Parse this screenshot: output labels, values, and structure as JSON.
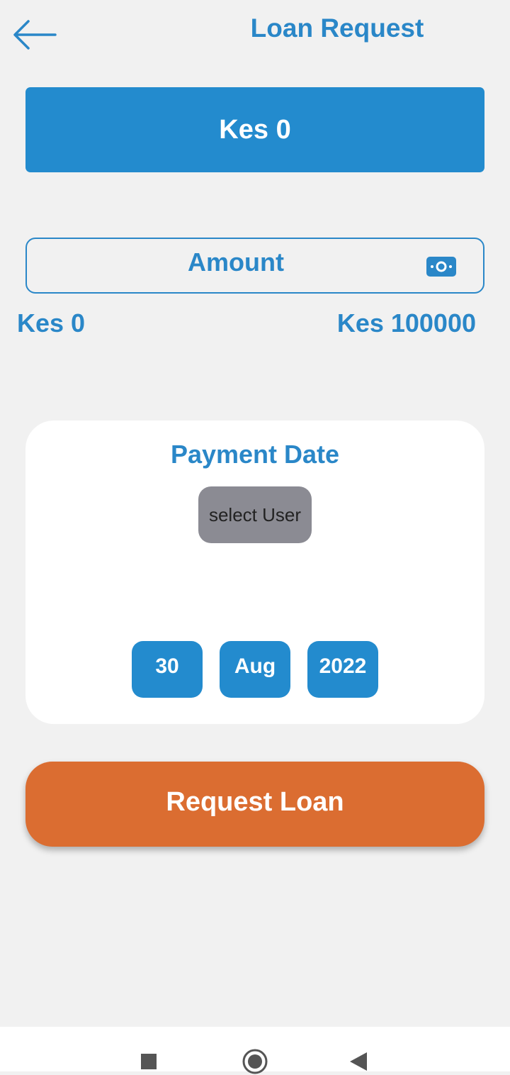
{
  "header": {
    "title": "Loan Request",
    "back_icon": "arrow-left-icon"
  },
  "balance": {
    "label": "Kes 0"
  },
  "amount": {
    "placeholder": "Amount",
    "value": "",
    "icon": "cash-icon"
  },
  "range": {
    "min_label": "Kes 0",
    "max_label": "Kes 100000"
  },
  "payment_date": {
    "title": "Payment Date",
    "select_user_label": "select User",
    "day": "30",
    "month": "Aug",
    "year": "2022"
  },
  "actions": {
    "request_label": "Request Loan"
  },
  "system_nav": {
    "recents_icon": "square-icon",
    "home_icon": "circle-icon",
    "back_icon": "triangle-back-icon"
  },
  "colors": {
    "primary_blue": "#238bce",
    "text_blue": "#2a87c8",
    "accent_orange": "#db6d31",
    "background": "#f1f1f1",
    "card_white": "#ffffff",
    "select_gray": "#8b8b93"
  }
}
